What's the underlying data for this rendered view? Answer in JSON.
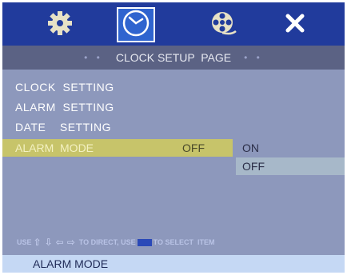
{
  "tabs": [
    {
      "icon": "gear-icon",
      "selected": false
    },
    {
      "icon": "clock-icon",
      "selected": true
    },
    {
      "icon": "film-reel-icon",
      "selected": false
    },
    {
      "icon": "close-icon",
      "selected": false
    }
  ],
  "page": {
    "title": "CLOCK SETUP  PAGE",
    "dots_left": "• •",
    "dots_right": "• •"
  },
  "menu": {
    "items": [
      {
        "label": "CLOCK  SETTING"
      },
      {
        "label": "ALARM  SETTING"
      },
      {
        "label": "DATE    SETTING"
      }
    ],
    "active": {
      "label": "ALARM  MODE",
      "value": "OFF"
    }
  },
  "options": [
    {
      "label": "ON",
      "selected": false
    },
    {
      "label": "OFF",
      "selected": true
    }
  ],
  "hint": {
    "prefix": "USE",
    "middle": "TO DIRECT, USE",
    "suffix": "TO SELECT  ITEM"
  },
  "status": {
    "text": "ALARM MODE"
  },
  "colors": {
    "icon_bar": "#213b9c",
    "background": "#8d98bc",
    "highlight": "#c7c46a",
    "option_selected": "#a7b8c9",
    "status_bar": "#c5d8f4"
  }
}
